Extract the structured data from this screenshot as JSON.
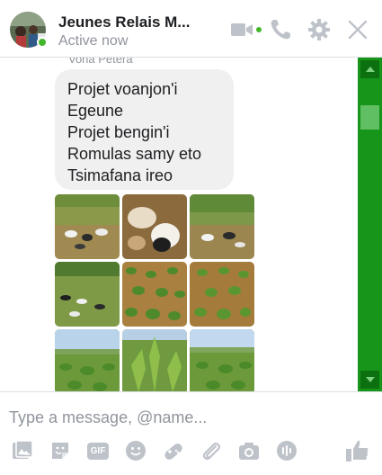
{
  "header": {
    "title": "Jeunes Relais M...",
    "status": "Active now",
    "icons": [
      "video-camera-icon",
      "phone-icon",
      "gear-icon",
      "close-icon"
    ],
    "accent_color": "#bec2c9",
    "online_color": "#42b72a"
  },
  "conversation": {
    "sender_name": "Vona Petera",
    "message_text": "Projet voanjon'i\nEgeune\nProjet bengin'i\nRomulas samy eto\nTsimafana ireo",
    "photos": [
      {
        "subject": "goats in a dry field"
      },
      {
        "subject": "close-up of goats"
      },
      {
        "subject": "goats in a dry field"
      },
      {
        "subject": "goats in a green field"
      },
      {
        "subject": "crop rows in a field"
      },
      {
        "subject": "crop rows in a field"
      },
      {
        "subject": "young crop field under sky"
      },
      {
        "subject": "tall bean plants"
      },
      {
        "subject": "young crop field under sky"
      }
    ]
  },
  "scrollbar": {
    "color": "#16951a"
  },
  "composer": {
    "placeholder": "Type a message, @name...",
    "gif_label": "GIF",
    "tools": [
      "photo-icon",
      "sticker-icon",
      "gif-icon",
      "emoji-icon",
      "game-icon",
      "attach-icon",
      "camera-icon",
      "audio-icon",
      "thumbs-up-icon"
    ]
  }
}
